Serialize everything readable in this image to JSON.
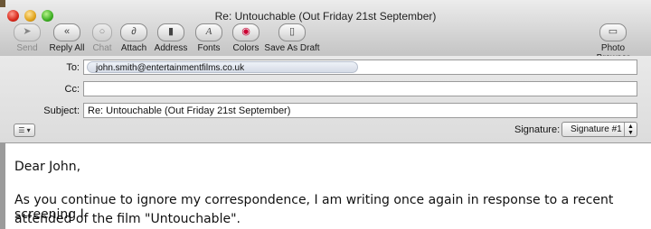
{
  "window": {
    "title": "Re: Untouchable (Out Friday 21st September)"
  },
  "toolbar": {
    "items": [
      {
        "label": "Send",
        "icon": "send-icon",
        "dim": true
      },
      {
        "label": "Reply All",
        "icon": "reply-all-icon",
        "dim": false
      },
      {
        "label": "Chat",
        "icon": "chat-icon",
        "dim": true
      },
      {
        "label": "Attach",
        "icon": "paperclip-icon",
        "dim": false
      },
      {
        "label": "Address",
        "icon": "address-book-icon",
        "dim": false
      },
      {
        "label": "Fonts",
        "icon": "fonts-icon",
        "dim": false
      },
      {
        "label": "Colors",
        "icon": "colors-icon",
        "dim": false
      },
      {
        "label": "Save As Draft",
        "icon": "draft-icon",
        "dim": false
      },
      {
        "label": "Photo Browser",
        "icon": "photo-browser-icon",
        "dim": false
      }
    ]
  },
  "header": {
    "to_label": "To:",
    "to_recipient": "john.smith@entertainmentfilms.co.uk",
    "cc_label": "Cc:",
    "cc_value": "",
    "subject_label": "Subject:",
    "subject_value": "Re: Untouchable (Out Friday 21st September)",
    "signature_label": "Signature:",
    "signature_value": "Signature #1"
  },
  "body": {
    "greeting": "Dear John,",
    "line1": "As you continue to ignore my correspondence, I am writing once again in response to a recent screening I",
    "line2": "attended of the film \"Untouchable\"."
  }
}
